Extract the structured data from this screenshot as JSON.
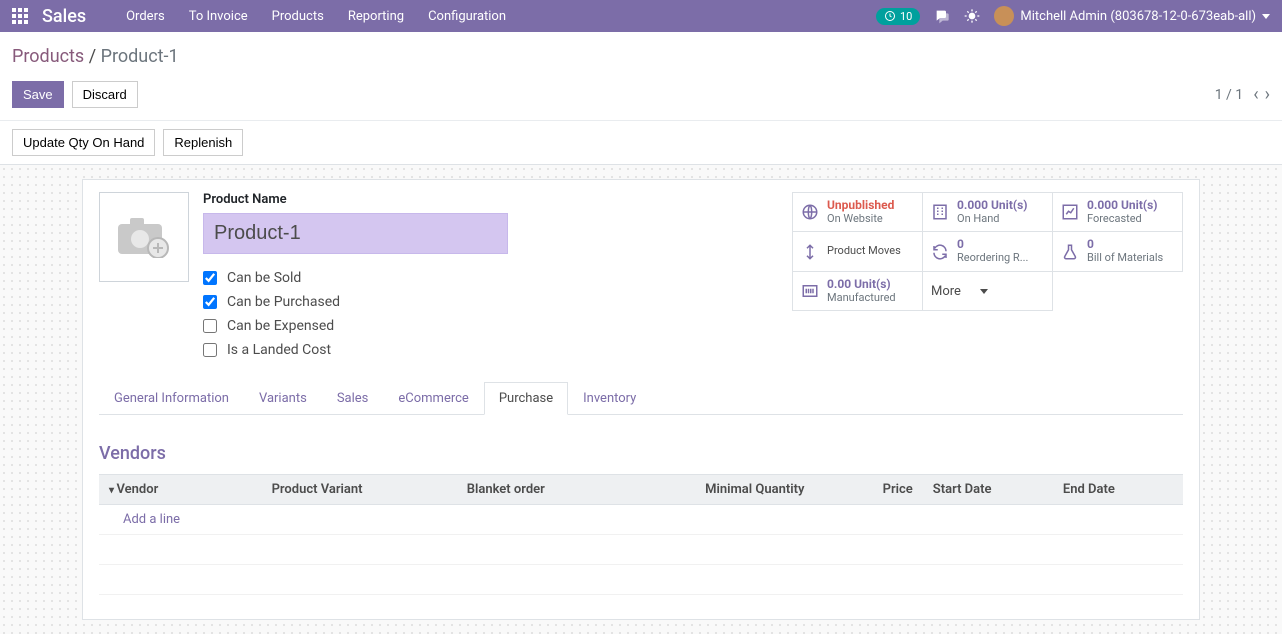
{
  "topnav": {
    "brand": "Sales",
    "menu": [
      "Orders",
      "To Invoice",
      "Products",
      "Reporting",
      "Configuration"
    ],
    "activity_count": "10",
    "user_name": "Mitchell Admin (803678-12-0-673eab-all)"
  },
  "breadcrumb": {
    "parent": "Products",
    "current": "Product-1"
  },
  "buttons": {
    "save": "Save",
    "discard": "Discard",
    "update_qty": "Update Qty On Hand",
    "replenish": "Replenish"
  },
  "pager": {
    "pos": "1 / 1"
  },
  "form": {
    "label_product_name": "Product Name",
    "product_name": "Product-1",
    "checks": {
      "can_be_sold": {
        "label": "Can be Sold",
        "checked": true
      },
      "can_be_purchased": {
        "label": "Can be Purchased",
        "checked": true
      },
      "can_be_expensed": {
        "label": "Can be Expensed",
        "checked": false
      },
      "landed_cost": {
        "label": "Is a Landed Cost",
        "checked": false
      }
    }
  },
  "stats": {
    "unpublished": {
      "top": "Unpublished",
      "sub": "On Website"
    },
    "on_hand": {
      "val": "0.000",
      "unit": "Unit(s)",
      "sub": "On Hand"
    },
    "forecasted": {
      "val": "0.000",
      "unit": "Unit(s)",
      "sub": "Forecasted"
    },
    "product_moves": {
      "label": "Product Moves"
    },
    "reordering": {
      "val": "0",
      "sub": "Reordering R..."
    },
    "bom": {
      "val": "0",
      "sub": "Bill of Materials"
    },
    "manufactured": {
      "val": "0.00",
      "unit": "Unit(s)",
      "sub": "Manufactured"
    },
    "more": {
      "label": "More"
    }
  },
  "tabs": [
    "General Information",
    "Variants",
    "Sales",
    "eCommerce",
    "Purchase",
    "Inventory"
  ],
  "active_tab": "Purchase",
  "vendors": {
    "title": "Vendors",
    "cols": {
      "vendor": "Vendor",
      "variant": "Product Variant",
      "blanket": "Blanket order",
      "minqty": "Minimal Quantity",
      "price": "Price",
      "start": "Start Date",
      "end": "End Date"
    },
    "add_line": "Add a line"
  }
}
